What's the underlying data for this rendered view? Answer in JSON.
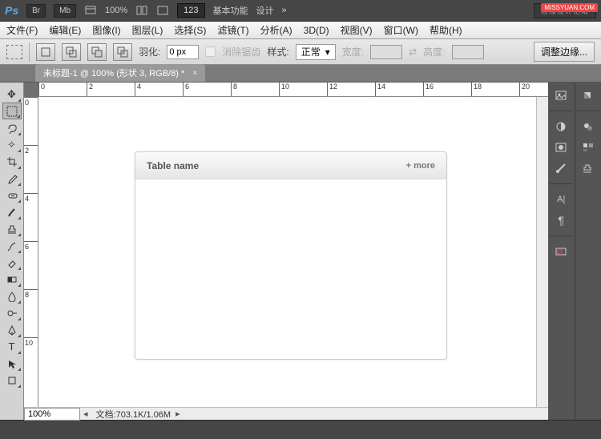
{
  "topbar": {
    "ps": "Ps",
    "br": "Br",
    "mb": "Mb",
    "zoom": "100%",
    "num": "123",
    "workspace1": "基本功能",
    "workspace2": "设计",
    "more": "»",
    "forum": "思缘设计论坛",
    "watermark": "MISSYUAN.COM"
  },
  "menus": {
    "file": "文件(F)",
    "edit": "编辑(E)",
    "image": "图像(I)",
    "layer": "图层(L)",
    "select": "选择(S)",
    "filter": "滤镜(T)",
    "analysis": "分析(A)",
    "threed": "3D(D)",
    "view": "视图(V)",
    "window": "窗口(W)",
    "help": "帮助(H)"
  },
  "optbar": {
    "feather_lbl": "羽化:",
    "feather_val": "0 px",
    "antialias": "消除锯齿",
    "style_lbl": "样式:",
    "style_val": "正常",
    "width_lbl": "宽度:",
    "height_lbl": "高度:",
    "refine": "调整边缘..."
  },
  "doctab": {
    "title": "未标题-1 @ 100% (形状 3, RGB/8) *",
    "close": "×"
  },
  "ruler": {
    "h": [
      "0",
      "2",
      "4",
      "6",
      "8",
      "10",
      "12",
      "14",
      "16",
      "18",
      "20"
    ],
    "v": [
      "0",
      "2",
      "4",
      "6",
      "8",
      "10"
    ]
  },
  "card": {
    "title": "Table name",
    "more": "+ more"
  },
  "status": {
    "zoom": "100%",
    "doc_lbl": "文档:",
    "doc_val": "703.1K/1.06M"
  }
}
